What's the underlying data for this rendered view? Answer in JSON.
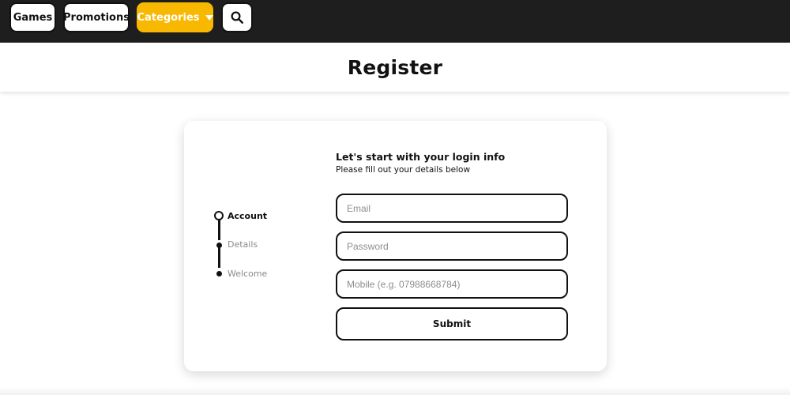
{
  "nav": {
    "games_label": "Games",
    "promotions_label": "Promotions",
    "categories_label": "Categories",
    "search_icon": "search-icon",
    "accent_color": "#f9b800",
    "bar_color": "#1f1e1e"
  },
  "page": {
    "title": "Register"
  },
  "stepper": {
    "steps": [
      {
        "label": "Account",
        "state": "active"
      },
      {
        "label": "Details",
        "state": "inactive"
      },
      {
        "label": "Welcome",
        "state": "inactive"
      }
    ]
  },
  "form": {
    "heading": "Let's start with your login info",
    "subheading": "Please fill out your details below",
    "email": {
      "value": "",
      "placeholder": "Email"
    },
    "password": {
      "value": "",
      "placeholder": "Password"
    },
    "mobile": {
      "value": "",
      "placeholder": "Mobile (e.g. 07988668784)"
    },
    "submit_label": "Submit"
  }
}
